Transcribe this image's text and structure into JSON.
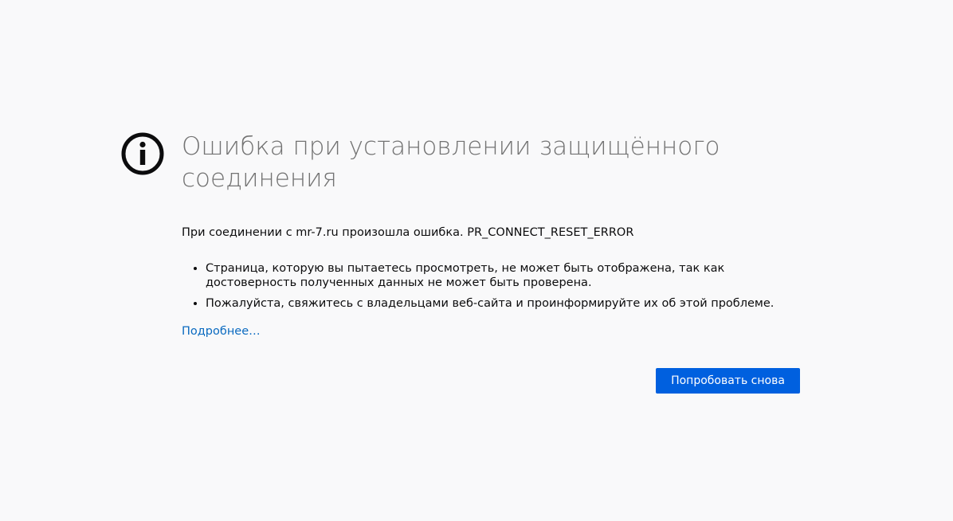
{
  "error": {
    "title": "Ошибка при установлении защищённого соединения",
    "short_desc": "При соединении с mr-7.ru произошла ошибка. PR_CONNECT_RESET_ERROR",
    "reasons": [
      "Страница, которую вы пытаетесь просмотреть, не может быть отображена, так как достоверность полученных данных не может быть проверена.",
      "Пожалуйста, свяжитесь с владельцами веб-сайта и проинформируйте их об этой проблеме."
    ],
    "learn_more": "Подробнее…",
    "try_again": "Попробовать снова"
  },
  "colors": {
    "background": "#f9f9fa",
    "title": "#737373",
    "link": "#0a6ac0",
    "button": "#0060df"
  },
  "icons": {
    "header_icon": "info-icon"
  }
}
